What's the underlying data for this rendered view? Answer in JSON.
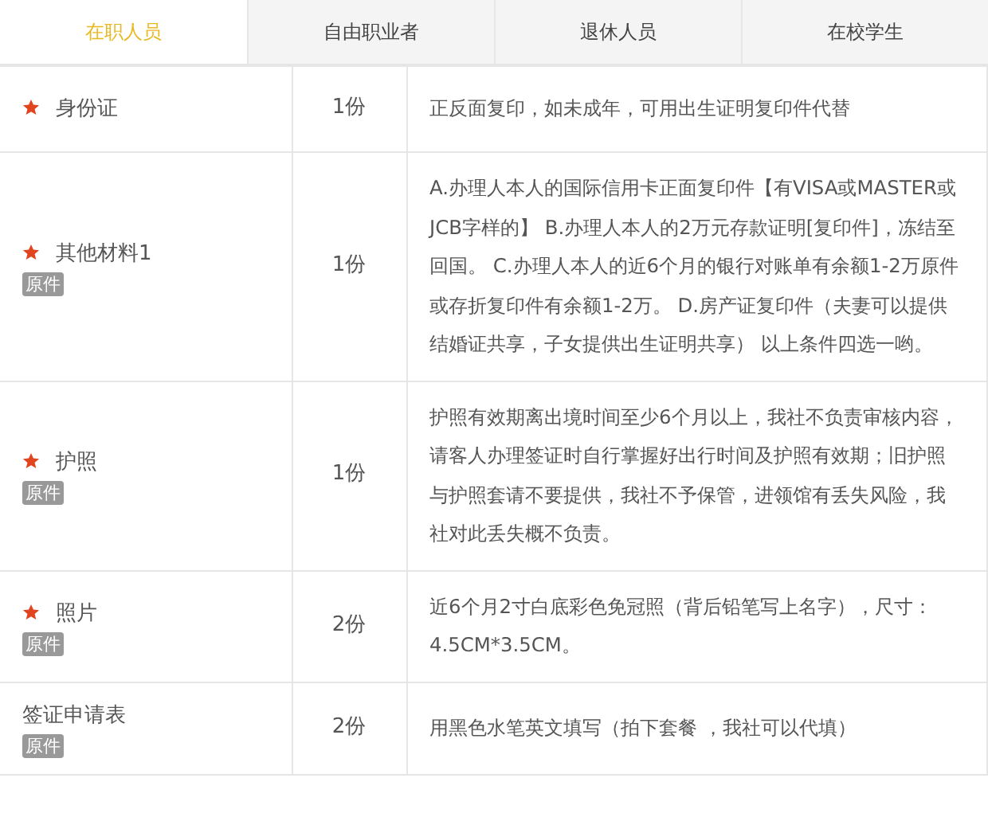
{
  "tabs": [
    {
      "label": "在职人员",
      "selected": true
    },
    {
      "label": "自由职业者",
      "selected": false
    },
    {
      "label": "退休人员",
      "selected": false
    },
    {
      "label": "在校学生",
      "selected": false
    }
  ],
  "rows": [
    {
      "required": true,
      "name": "身份证",
      "count": "1份",
      "description": "正反面复印，如未成年，可用出生证明复印件代替"
    },
    {
      "required": true,
      "name": "其他材料1",
      "tag": "原件",
      "count": "1份",
      "description": "A.办理人本人的国际信用卡正面复印件【有VISA或MASTER或JCB字样的】 B.办理人本人的2万元存款证明[复印件]，冻结至回国。 C.办理人本人的近6个月的银行对账单有余额1-2万原件或存折复印件有余额1-2万。 D.房产证复印件（夫妻可以提供结婚证共享，子女提供出生证明共享） 以上条件四选一哟。"
    },
    {
      "required": true,
      "name": "护照",
      "tag": "原件",
      "count": "1份",
      "description": "护照有效期离出境时间至少6个月以上，我社不负责审核内容，请客人办理签证时自行掌握好出行时间及护照有效期；旧护照与护照套请不要提供，我社不予保管，进领馆有丢失风险，我社对此丢失概不负责。"
    },
    {
      "required": true,
      "name": "照片",
      "tag": "原件",
      "count": "2份",
      "description": "近6个月2寸白底彩色免冠照（背后铅笔写上名字），尺寸：4.5CM*3.5CM。"
    },
    {
      "required": false,
      "name": "签证申请表",
      "tag": "原件",
      "count": "2份",
      "description": "用黑色水笔英文填写（拍下套餐 ，我社可以代填）"
    }
  ]
}
